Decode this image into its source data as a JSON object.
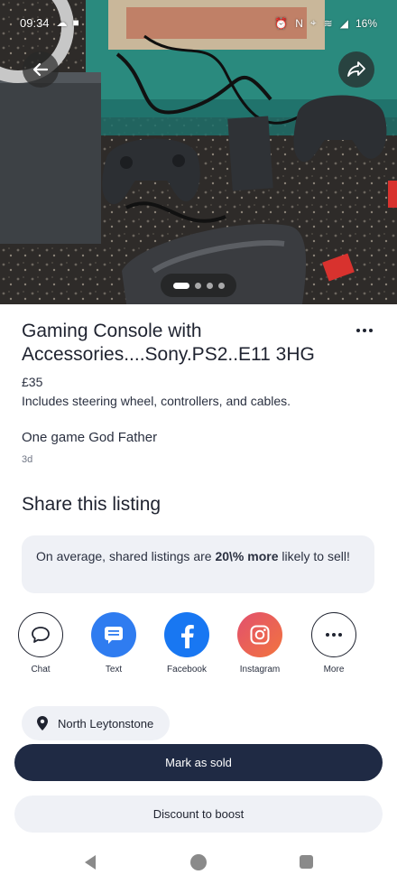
{
  "status_bar": {
    "time": "09:34",
    "battery": "16%"
  },
  "photo": {
    "page_index": 1,
    "page_count": 4
  },
  "listing": {
    "title": "Gaming Console with Accessories....Sony.PS2..E11 3HG",
    "price": "£35",
    "description": "Includes steering wheel, controllers, and cables.",
    "extra_note": "One game God Father",
    "posted_ago": "3d"
  },
  "share": {
    "heading": "Share this listing",
    "info_prefix": "On average, shared listings are ",
    "info_highlight": "20\\% more",
    "info_suffix": " likely to sell!",
    "options": [
      {
        "label": "Chat",
        "icon": "chat-bubble-icon"
      },
      {
        "label": "Text",
        "icon": "message-icon"
      },
      {
        "label": "Facebook",
        "icon": "facebook-icon"
      },
      {
        "label": "Instagram",
        "icon": "instagram-icon"
      },
      {
        "label": "More",
        "icon": "more-icon"
      }
    ]
  },
  "location": {
    "label": "North Leytonstone"
  },
  "actions": {
    "mark_sold": "Mark as sold",
    "discount_boost": "Discount to boost"
  },
  "colors": {
    "primary_button": "#1f2a44",
    "text_blue": "#2f7cf0",
    "facebook_blue": "#1877f2",
    "instagram_orange": "#f2743e",
    "light_surface": "#eff1f6"
  }
}
